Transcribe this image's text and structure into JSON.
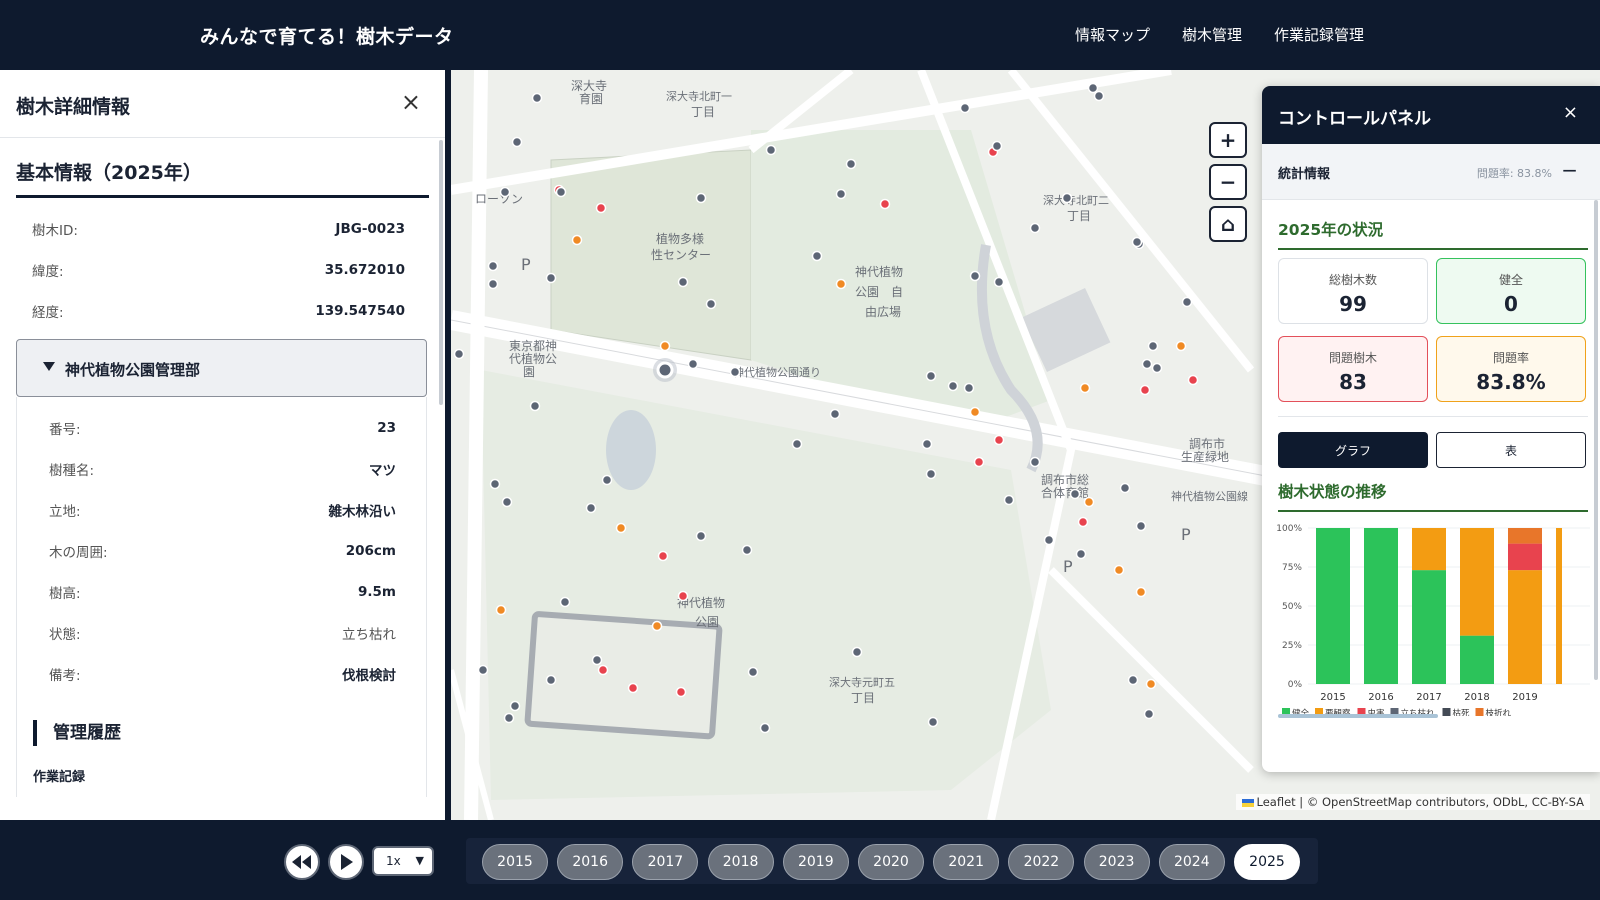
{
  "header": {
    "title": "みんなで育てる！樹木データ",
    "nav": [
      "情報マップ",
      "樹木管理",
      "作業記録管理"
    ]
  },
  "detail": {
    "title": "樹木詳細情報",
    "close": "×",
    "section_title": "基本情報（2025年）",
    "basic": [
      {
        "label": "樹木ID:",
        "value": "JBG-0023"
      },
      {
        "label": "緯度:",
        "value": "35.672010"
      },
      {
        "label": "経度:",
        "value": "139.547540"
      }
    ],
    "org": "神代植物公園管理部",
    "org_rows": [
      {
        "label": "番号:",
        "value": "23"
      },
      {
        "label": "樹種名:",
        "value": "マツ"
      },
      {
        "label": "立地:",
        "value": "雑木林沿い"
      },
      {
        "label": "木の周囲:",
        "value": "206cm"
      },
      {
        "label": "樹高:",
        "value": "9.5m"
      },
      {
        "label": "状態:",
        "value": "立ち枯れ"
      },
      {
        "label": "備考:",
        "value": "伐根検討"
      }
    ],
    "history_title": "管理履歴",
    "history_sub": "作業記録"
  },
  "map": {
    "labels": [
      {
        "text": "深大寺北町一",
        "x": 215,
        "y": 30
      },
      {
        "text": "丁目",
        "x": 240,
        "y": 46
      },
      {
        "text": "植物多様",
        "x": 205,
        "y": 173
      },
      {
        "text": "性センター",
        "x": 200,
        "y": 189
      },
      {
        "text": "神代植物",
        "x": 404,
        "y": 206
      },
      {
        "text": "公園　自",
        "x": 404,
        "y": 226
      },
      {
        "text": "由広場",
        "x": 414,
        "y": 246
      },
      {
        "text": "神代植物公園通り",
        "x": 282,
        "y": 306
      },
      {
        "text": "神代植物",
        "x": 226,
        "y": 537
      },
      {
        "text": "公園",
        "x": 244,
        "y": 556
      },
      {
        "text": "深大寺元町五",
        "x": 378,
        "y": 616
      },
      {
        "text": "丁目",
        "x": 400,
        "y": 632
      },
      {
        "text": "深大寺北町二",
        "x": 592,
        "y": 134
      },
      {
        "text": "丁目",
        "x": 616,
        "y": 150
      },
      {
        "text": "東京都神",
        "x": 58,
        "y": 280
      },
      {
        "text": "代植物公",
        "x": 58,
        "y": 293
      },
      {
        "text": "園",
        "x": 72,
        "y": 306
      },
      {
        "text": "調布市総",
        "x": 590,
        "y": 414
      },
      {
        "text": "合体育館",
        "x": 590,
        "y": 427
      },
      {
        "text": "調布市",
        "x": 738,
        "y": 378
      },
      {
        "text": "生産緑地",
        "x": 730,
        "y": 391
      },
      {
        "text": "神代植物公園線",
        "x": 720,
        "y": 430
      },
      {
        "text": "ローソン",
        "x": 24,
        "y": 133
      },
      {
        "text": "深大寺",
        "x": 120,
        "y": 20
      },
      {
        "text": "育園",
        "x": 128,
        "y": 33
      },
      {
        "text": "P",
        "x": 70,
        "y": 200
      },
      {
        "text": "P",
        "x": 730,
        "y": 470
      },
      {
        "text": "P",
        "x": 612,
        "y": 502
      }
    ],
    "zoom_in": "+",
    "zoom_out": "−",
    "home": "⌂",
    "attribution": "Leaflet | © OpenStreetMap contributors, ODbL, CC-BY-SA"
  },
  "control_panel": {
    "title": "コントロールパネル",
    "close": "×",
    "stats_title": "統計情報",
    "problem_rate_label": "問題率: 83.8%",
    "collapse": "−",
    "year_status": "2025年の状況",
    "cards": {
      "total_label": "総樹木数",
      "total_value": "99",
      "healthy_label": "健全",
      "healthy_value": "0",
      "problem_label": "問題樹木",
      "problem_value": "83",
      "rate_label": "問題率",
      "rate_value": "83.8%"
    },
    "graph_btn": "グラフ",
    "table_btn": "表",
    "trend_title": "樹木状態の推移",
    "colors": {
      "healthy": "#2cc35a",
      "observe": "#f39c12",
      "pest": "#e8434e",
      "standing_dead": "#5d6675",
      "dead": "#434a55",
      "broken": "#e8762a"
    }
  },
  "chart_data": {
    "type": "bar",
    "stacked": true,
    "categories": [
      "2015",
      "2016",
      "2017",
      "2018",
      "2019"
    ],
    "series": [
      {
        "name": "健全",
        "values": [
          100,
          100,
          73,
          31,
          0
        ]
      },
      {
        "name": "要観察",
        "values": [
          0,
          0,
          27,
          69,
          73
        ]
      },
      {
        "name": "虫害",
        "values": [
          0,
          0,
          0,
          0,
          17
        ]
      },
      {
        "name": "立ち枯れ",
        "values": [
          0,
          0,
          0,
          0,
          0
        ]
      },
      {
        "name": "枯死",
        "values": [
          0,
          0,
          0,
          0,
          0
        ]
      },
      {
        "name": "枝折れ",
        "values": [
          0,
          0,
          0,
          0,
          10
        ]
      }
    ],
    "yticks": [
      "100%",
      "75%",
      "50%",
      "25%",
      "0%"
    ],
    "ylim": [
      0,
      100
    ],
    "legend_position": "bottom"
  },
  "timeline": {
    "speed": "1x",
    "years": [
      "2015",
      "2016",
      "2017",
      "2018",
      "2019",
      "2020",
      "2021",
      "2022",
      "2023",
      "2024",
      "2025"
    ],
    "active": "2025"
  }
}
